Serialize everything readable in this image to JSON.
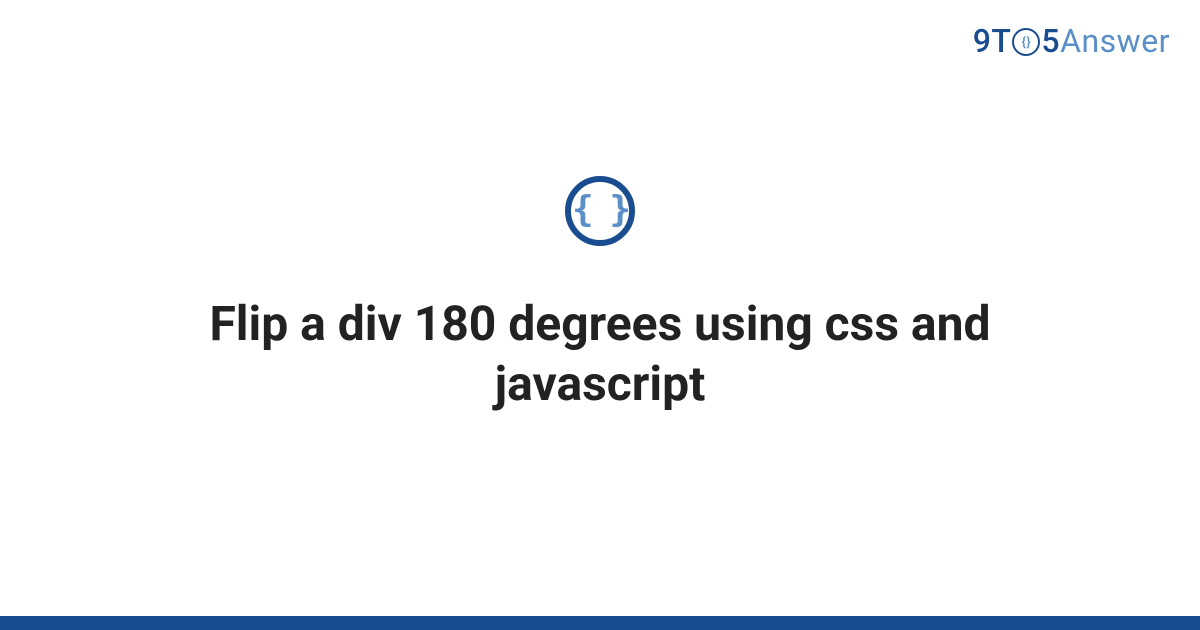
{
  "logo": {
    "part1": "9T",
    "circle_inner": "{}",
    "part2": "5",
    "part3": "Answer"
  },
  "badge": {
    "icon_name": "code-braces-icon",
    "glyph": "{ }"
  },
  "title": "Flip a div 180 degrees using css and javascript",
  "colors": {
    "primary": "#1a4d8f",
    "secondary": "#5a8fc7",
    "text": "#222222"
  }
}
